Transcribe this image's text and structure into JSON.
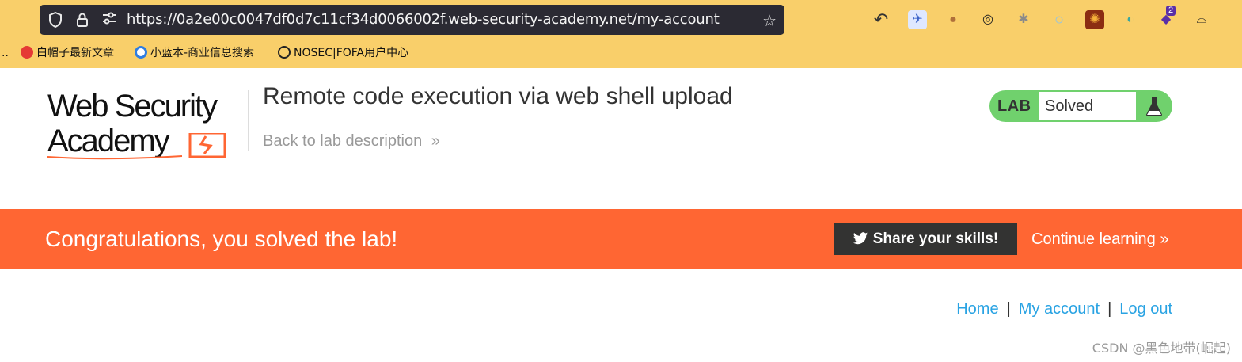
{
  "browser": {
    "url": "https://0a2e00c0047df0d7c11cf34d0066002f.web-security-academy.net/my-account",
    "icons": {
      "shield": "shield-icon",
      "lock": "lock-icon",
      "permissions": "permissions-icon",
      "bookmark_star": "star-icon"
    },
    "extensions": [
      "back-arrow-icon",
      "bird-icon",
      "cookie-icon",
      "cookie-editor-icon",
      "bug-icon",
      "ring-icon",
      "sun-icon",
      "toggle-icon",
      "hackbar-icon",
      "hat-icon"
    ],
    "extension_badge": "2",
    "bookmarks": [
      {
        "label": "白帽子最新文章"
      },
      {
        "label": "小蓝本-商业信息搜索"
      },
      {
        "label": "NOSEC|FOFA用户中心"
      }
    ],
    "bookmarks_overflow": ".."
  },
  "header": {
    "logo_line1": "Web Security",
    "logo_line2": "Academy",
    "lab_title": "Remote code execution via web shell upload",
    "back_link": "Back to lab description",
    "lab_label": "LAB",
    "lab_status": "Solved",
    "status_color": "#70d16d"
  },
  "banner": {
    "message": "Congratulations, you solved the lab!",
    "share_label": "Share your skills!",
    "continue_label": "Continue learning",
    "color": "#ff6633"
  },
  "nav": {
    "home": "Home",
    "separator": "|",
    "my_account": "My account",
    "log_out": "Log out",
    "link_color": "#29a3e3"
  },
  "watermark": "CSDN @黑色地带(崛起)"
}
